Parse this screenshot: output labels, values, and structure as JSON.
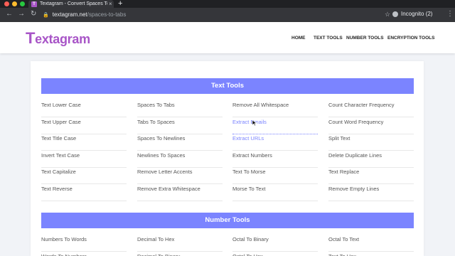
{
  "browser": {
    "tab_title": "Textagram - Convert Spaces To",
    "favicon_letter": "T",
    "new_tab": "+",
    "url_domain": "textagram.net",
    "url_path": "/spaces-to-tabs",
    "incognito_label": "Incognito (2)"
  },
  "site": {
    "logo_first": "T",
    "logo_rest": "extagram",
    "nav": [
      "HOME",
      "TEXT TOOLS",
      "NUMBER TOOLS",
      "ENCRYPTION TOOLS"
    ]
  },
  "text_tools": {
    "title": "Text Tools",
    "columns": [
      [
        "Text Lower Case",
        "Text Upper Case",
        "Text Title Case",
        "Invert Text Case",
        "Text Capitalize",
        "Text Reverse"
      ],
      [
        "Spaces To Tabs",
        "Tabs To Spaces",
        "Spaces To Newlines",
        "Newlines To Spaces",
        "Remove Letter Accents",
        "Remove Extra Whitespace"
      ],
      [
        "Remove All Whitespace",
        "Extract Emails",
        "Extract URLs",
        "Extract Numbers",
        "Text To Morse",
        "Morse To Text"
      ],
      [
        "Count Character Frequency",
        "Count Word Frequency",
        "Split Text",
        "Delete Duplicate Lines",
        "Text Replace",
        "Remove Empty Lines"
      ]
    ]
  },
  "number_tools": {
    "title": "Number Tools",
    "columns": [
      [
        "Numbers To Words",
        "Words To Numbers"
      ],
      [
        "Decimal To Hex",
        "Decimal To Binary"
      ],
      [
        "Octal To Binary",
        "Octal To Hex"
      ],
      [
        "Octal To Text",
        "Text To Hex"
      ]
    ]
  }
}
